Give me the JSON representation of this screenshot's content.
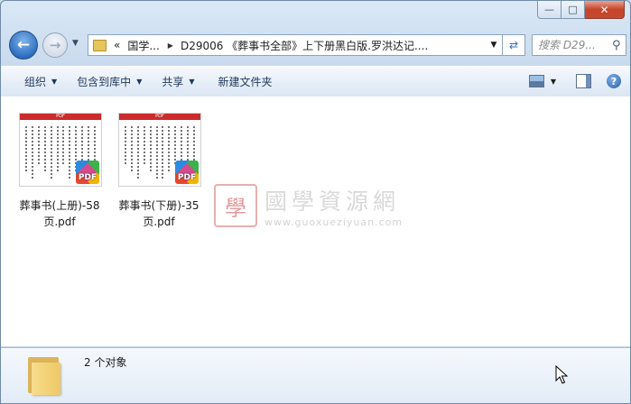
{
  "window": {
    "caption": {
      "minimize": "—",
      "maximize": "□",
      "close": "✕"
    }
  },
  "nav": {
    "back_icon": "back-arrow-icon",
    "forward_icon": "forward-arrow-icon",
    "address": {
      "overflow": "«",
      "segment_1": "国学...",
      "separator": "▶",
      "segment_2": "D29006 《葬事书全部》上下册黑白版.罗洪达记...."
    },
    "search_placeholder": "搜索 D29..."
  },
  "toolbar": {
    "organize": "组织",
    "include_in_library": "包含到库中",
    "share": "共享",
    "new_folder": "新建文件夹",
    "arrow": "▼",
    "help": "?"
  },
  "files": [
    {
      "name": "葬事书(上册)-58页.pdf",
      "badge": "PDF",
      "thumb_header": "PDF"
    },
    {
      "name": "葬事书(下册)-35页.pdf",
      "badge": "PDF",
      "thumb_header": "PDF"
    }
  ],
  "watermark": {
    "logo_char": "學",
    "title": "國學資源網",
    "url": "www.guoxueziyuan.com"
  },
  "status": {
    "count_text": "2 个对象"
  },
  "colors": {
    "accent": "#1e395b",
    "pdf_red": "#cc2b2b",
    "folder": "#efc866"
  }
}
